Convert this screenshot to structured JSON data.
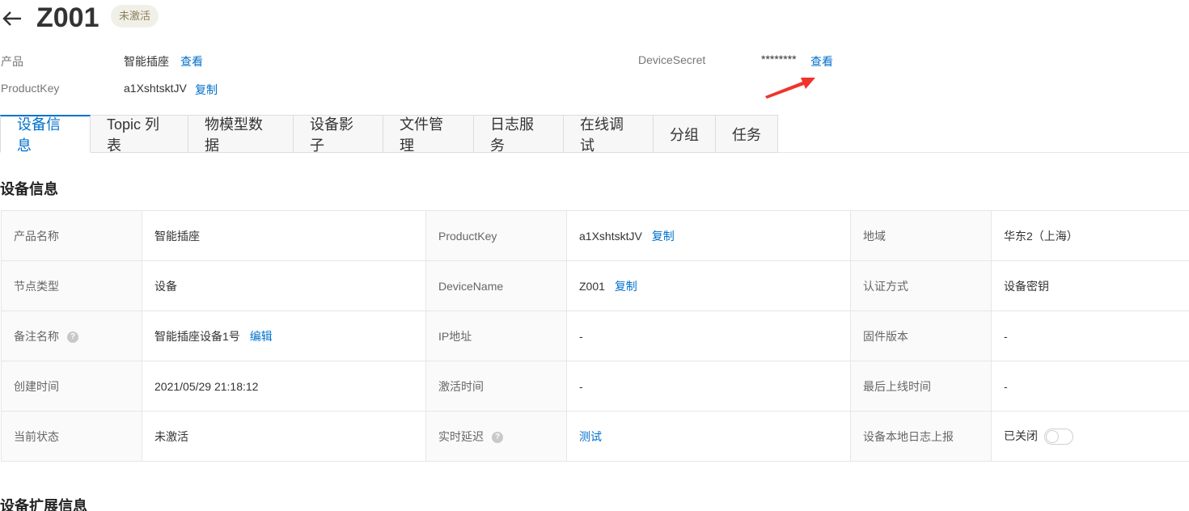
{
  "header": {
    "title": "Z001",
    "status": "未激活"
  },
  "meta": {
    "product_label": "产品",
    "product_value": "智能插座",
    "product_link": "查看",
    "productkey_label": "ProductKey",
    "productkey_value": "a1XshtsktJV",
    "productkey_link": "复制",
    "secret_label": "DeviceSecret",
    "secret_value": "********",
    "secret_link": "查看"
  },
  "tabs": [
    "设备信息",
    "Topic 列表",
    "物模型数据",
    "设备影子",
    "文件管理",
    "日志服务",
    "在线调试",
    "分组",
    "任务"
  ],
  "sections": {
    "device_info": "设备信息",
    "ext_info": "设备扩展信息"
  },
  "table": {
    "r1": {
      "l1": "产品名称",
      "v1": "智能插座",
      "l2": "ProductKey",
      "v2": "a1XshtsktJV",
      "v2_link": "复制",
      "l3": "地域",
      "v3": "华东2（上海）"
    },
    "r2": {
      "l1": "节点类型",
      "v1": "设备",
      "l2": "DeviceName",
      "v2": "Z001",
      "v2_link": "复制",
      "l3": "认证方式",
      "v3": "设备密钥"
    },
    "r3": {
      "l1": "备注名称",
      "v1": "智能插座设备1号",
      "v1_link": "编辑",
      "l2": "IP地址",
      "v2": "-",
      "l3": "固件版本",
      "v3": "-"
    },
    "r4": {
      "l1": "创建时间",
      "v1": "2021/05/29 21:18:12",
      "l2": "激活时间",
      "v2": "-",
      "l3": "最后上线时间",
      "v3": "-"
    },
    "r5": {
      "l1": "当前状态",
      "v1": "未激活",
      "l2": "实时延迟",
      "v2_link": "测试",
      "l3": "设备本地日志上报",
      "v3": "已关闭"
    }
  },
  "help_glyph": "?",
  "colors": {
    "accent": "#0070cc",
    "arrow": "#f0342a"
  }
}
